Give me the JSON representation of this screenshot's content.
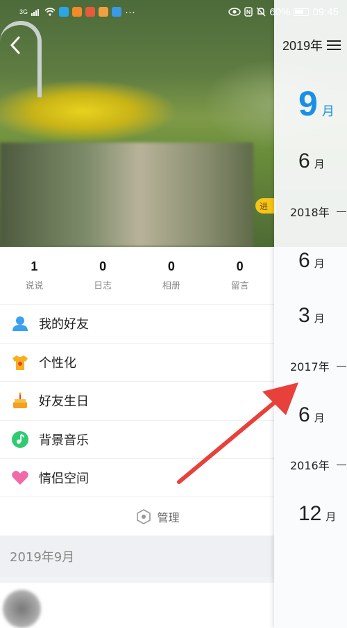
{
  "status_bar": {
    "signal": "3G",
    "battery": "60%",
    "time": "09:45",
    "more": "···"
  },
  "cover": {
    "badge_text": "进"
  },
  "stats": [
    {
      "value": "1",
      "label": "说说"
    },
    {
      "value": "0",
      "label": "日志"
    },
    {
      "value": "0",
      "label": "相册"
    },
    {
      "value": "0",
      "label": "留言"
    }
  ],
  "menu": [
    {
      "label": "我的好友",
      "icon": "friends-icon"
    },
    {
      "label": "个性化",
      "icon": "tshirt-icon"
    },
    {
      "label": "好友生日",
      "icon": "cake-icon"
    },
    {
      "label": "背景音乐",
      "icon": "music-icon"
    },
    {
      "label": "情侣空间",
      "icon": "heart-icon"
    }
  ],
  "manage_label": "管理",
  "date_header": "2019年9月",
  "timeline": {
    "top_year": "2019年",
    "active_month": {
      "num": "9",
      "unit": "月"
    },
    "entries": [
      {
        "type": "month",
        "num": "6",
        "unit": "月"
      },
      {
        "type": "year",
        "label": "2018年"
      },
      {
        "type": "month",
        "num": "6",
        "unit": "月"
      },
      {
        "type": "month",
        "num": "3",
        "unit": "月"
      },
      {
        "type": "year",
        "label": "2017年"
      },
      {
        "type": "month",
        "num": "6",
        "unit": "月"
      },
      {
        "type": "year",
        "label": "2016年"
      },
      {
        "type": "month",
        "num": "12",
        "unit": "月"
      }
    ]
  },
  "colors": {
    "accent": "#1a8fe8",
    "arrow": "#e8403a"
  }
}
